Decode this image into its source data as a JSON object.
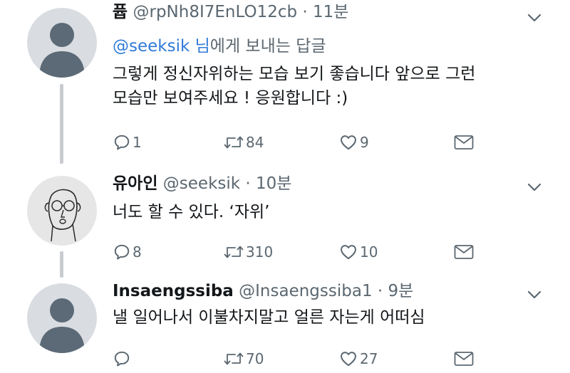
{
  "tweets": [
    {
      "name": "퓹",
      "handle": "@rpNh8I7EnLO12cb",
      "dot": "·",
      "time": "11분",
      "reply_mention": "@seeksik 님",
      "reply_suffix": "에게 보내는 답글",
      "line1": "그렇게 정신자위하는 모습 보기 좋습니다 앞으로 그런",
      "line2": "모습만 보여주세요 ! 응원합니다 :)",
      "replies": "1",
      "retweets": "84",
      "likes": "9"
    },
    {
      "name": "유아인",
      "handle": "@seeksik",
      "dot": "·",
      "time": "10분",
      "line1": "너도 할 수 있다. ‘자위’",
      "replies": "8",
      "retweets": "310",
      "likes": "10"
    },
    {
      "name": "Insaengssiba",
      "handle": "@Insaengssiba1",
      "dot": "·",
      "time": "9분",
      "line1": "낼 일어나서 이불차지말고 얼른 자는게 어떠심",
      "replies": "",
      "retweets": "70",
      "likes": "27"
    }
  ],
  "colors": {
    "text": "#14171a",
    "muted": "#5b6770",
    "link": "#2f7bd9",
    "thread": "#c8ccd0"
  }
}
